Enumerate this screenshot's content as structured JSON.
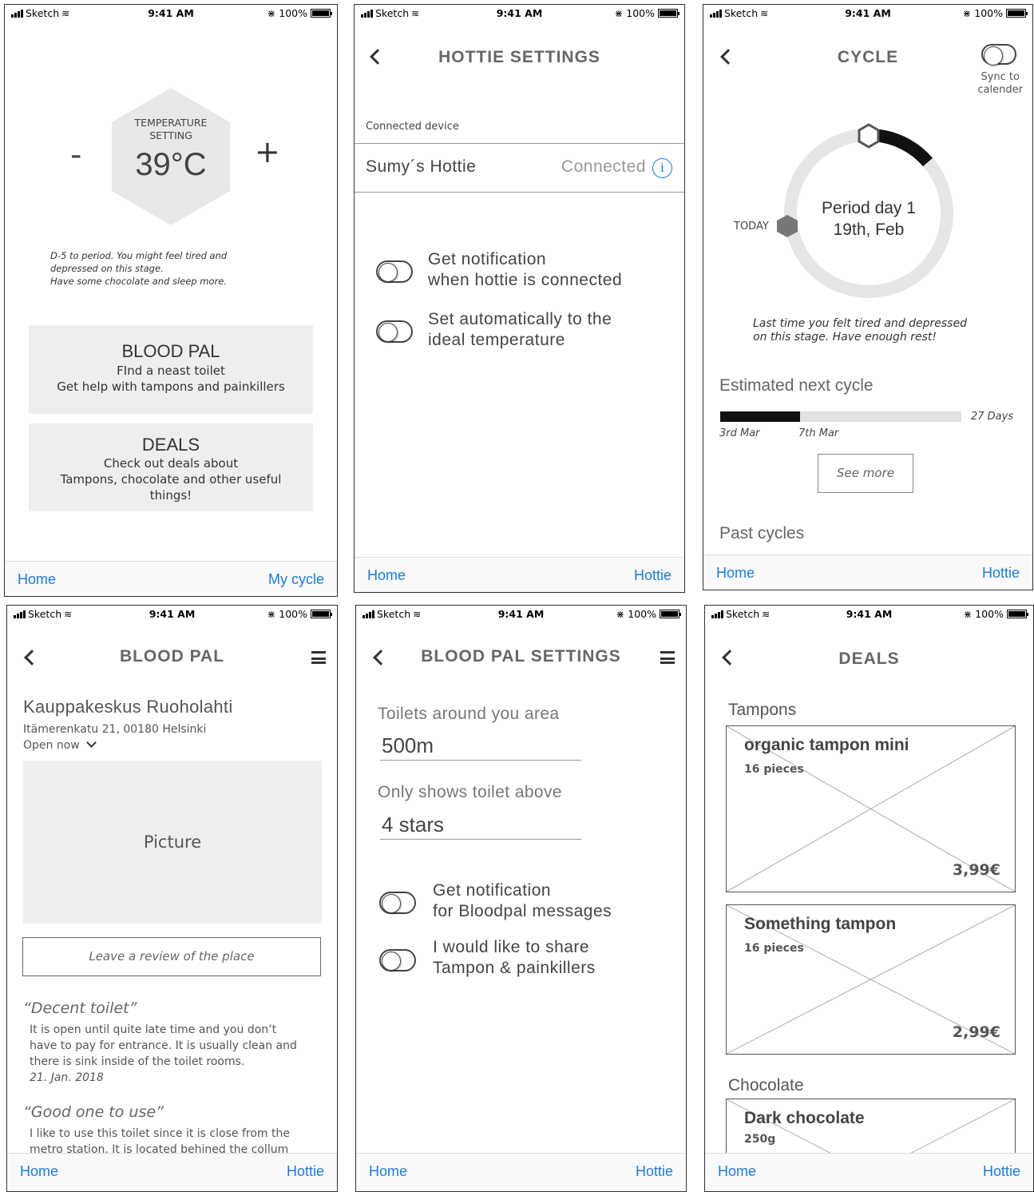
{
  "status_bar": {
    "carrier": "Sketch",
    "time": "9:41 AM",
    "battery": "100%"
  },
  "screen1": {
    "hex_label_1": "TEMPERATURE",
    "hex_label_2": "SETTING",
    "temp": "39°C",
    "minus": "-",
    "plus": "+",
    "message": [
      "D-5 to period. You might feel tired and",
      "depressed on this stage.",
      "Have some chocolate and sleep more."
    ],
    "blood_title": "BLOOD PAL",
    "blood_line1": "FInd a neast toilet",
    "blood_line2": "Get help with tampons and painkillers",
    "deals_title": "DEALS",
    "deals_line1": "Check out deals about",
    "deals_line2": "Tampons, chocolate and other useful",
    "deals_line3": "things!",
    "tab_left": "Home",
    "tab_right": "My cycle"
  },
  "screen2": {
    "title": "HOTTIE SETTINGS",
    "section": "Connected device",
    "device": "Sumy´s Hottie",
    "status": "Connected",
    "info_glyph": "i",
    "toggle1": [
      "Get notification",
      "when hottie is connected"
    ],
    "toggle2": [
      "Set automatically to the",
      "ideal temperature"
    ],
    "tab_left": "Home",
    "tab_right": "Hottie"
  },
  "screen3": {
    "title": "CYCLE",
    "sync": [
      "Sync to",
      "calender"
    ],
    "today": "TODAY",
    "period": "Period day 1",
    "date": "19th, Feb",
    "note": [
      "Last time you felt tired and depressed",
      "on this stage. Have enough rest!"
    ],
    "estimated": "Estimated next cycle",
    "days": "27 Days",
    "start": "3rd Mar",
    "end": "7th Mar",
    "progress": 0.33,
    "see_more": "See more",
    "past": "Past cycles",
    "tab_left": "Home",
    "tab_right": "Hottie"
  },
  "screen4": {
    "title": "BLOOD PAL",
    "place": "Kauppakeskus Ruoholahti",
    "address": "Itämerenkatu 21, 00180 Helsinki",
    "open": "Open now",
    "picture": "Picture",
    "review_placeholder": "Leave a review of the place",
    "r1_title": "“Decent toilet”",
    "r1_body": [
      "It is open until quite late time and you don’t",
      "have to pay for entrance. It is usually clean and",
      "there is sink inside of the toilet rooms."
    ],
    "r1_date": "21. Jan. 2018",
    "r2_title": "“Good one to use”",
    "r2_body": [
      "I like to use this toilet since it is close from the",
      "metro station. It is located behined the collum"
    ],
    "tab_left": "Home",
    "tab_right": "Hottie"
  },
  "screen5": {
    "title": "BLOOD PAL SETTINGS",
    "area_label": "Toilets around you area",
    "area_value": "500m",
    "stars_label": "Only shows toilet above",
    "stars_value": "4 stars",
    "toggle1": [
      "Get notification",
      "for Bloodpal messages"
    ],
    "toggle2": [
      "I would like to share",
      "Tampon & painkillers"
    ],
    "tab_left": "Home",
    "tab_right": "Hottie"
  },
  "screen6": {
    "title": "DEALS",
    "cat1": "Tampons",
    "cat2": "Chocolate",
    "items": [
      {
        "name": "organic tampon mini",
        "qty": "16 pieces",
        "price": "3,99€"
      },
      {
        "name": "Something tampon",
        "qty": "16 pieces",
        "price": "2,99€"
      },
      {
        "name": "Dark chocolate",
        "qty": "250g"
      }
    ],
    "tab_left": "Home",
    "tab_right": "Hottie"
  }
}
